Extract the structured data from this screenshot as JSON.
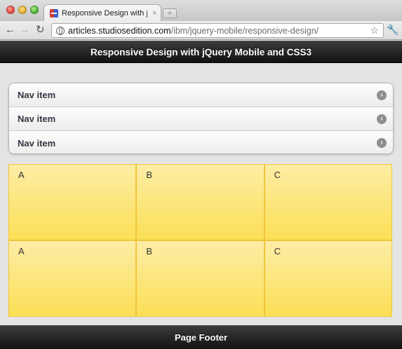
{
  "browser": {
    "tab_title": "Responsive Design with jQuer",
    "tab_close": "×",
    "new_tab": "+",
    "url_host": "articles.studiosedition.com",
    "url_path": "/ibm/jquery-mobile/responsive-design/"
  },
  "header": {
    "title": "Responsive Design with jQuery Mobile and CSS3"
  },
  "nav": {
    "items": [
      {
        "label": "Nav item"
      },
      {
        "label": "Nav item"
      },
      {
        "label": "Nav item"
      }
    ]
  },
  "grid": {
    "rows": [
      [
        "A",
        "B",
        "C"
      ],
      [
        "A",
        "B",
        "C"
      ]
    ]
  },
  "footer": {
    "title": "Page Footer"
  },
  "icons": [
    "back-icon",
    "forward-icon",
    "reload-icon",
    "globe-icon",
    "star-icon",
    "wrench-icon",
    "arrow-right-icon"
  ],
  "colors": {
    "header_bg": "#1c1c1c",
    "cell_top": "#fdeda6",
    "cell_bottom": "#fbdf55"
  }
}
